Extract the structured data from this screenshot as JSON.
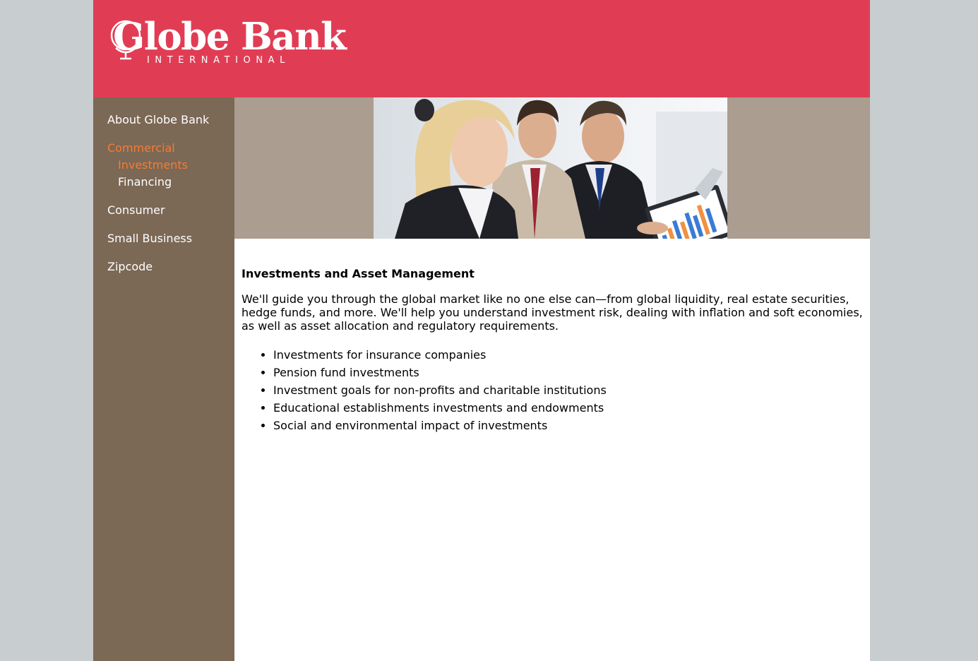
{
  "brand": {
    "name": "Globe Bank",
    "tagline": "INTERNATIONAL",
    "header_color": "#e03d55"
  },
  "sidebar": {
    "color": "#7b6855",
    "active_color": "#f47c33",
    "items": [
      {
        "label": "About Globe Bank",
        "active": false
      },
      {
        "label": "Commercial",
        "active": true,
        "children": [
          {
            "label": "Investments",
            "active": true
          },
          {
            "label": "Financing",
            "active": false
          }
        ]
      },
      {
        "label": "Consumer",
        "active": false
      },
      {
        "label": "Small Business",
        "active": false
      },
      {
        "label": "Zipcode",
        "active": false
      }
    ]
  },
  "banner": {
    "photo_icon": "business-meeting-photo"
  },
  "main": {
    "title": "Investments and Asset Management",
    "intro": "We'll guide you through the global market like no one else can—from global liquidity, real estate securities, hedge funds, and more. We'll help you understand investment risk, dealing with inflation and soft economies, as well as asset allocation and regulatory requirements.",
    "bullets": [
      "Investments for insurance companies",
      "Pension fund investments",
      "Investment goals for non-profits and charitable institutions",
      "Educational establishments investments and endowments",
      "Social and environmental impact of investments"
    ]
  }
}
